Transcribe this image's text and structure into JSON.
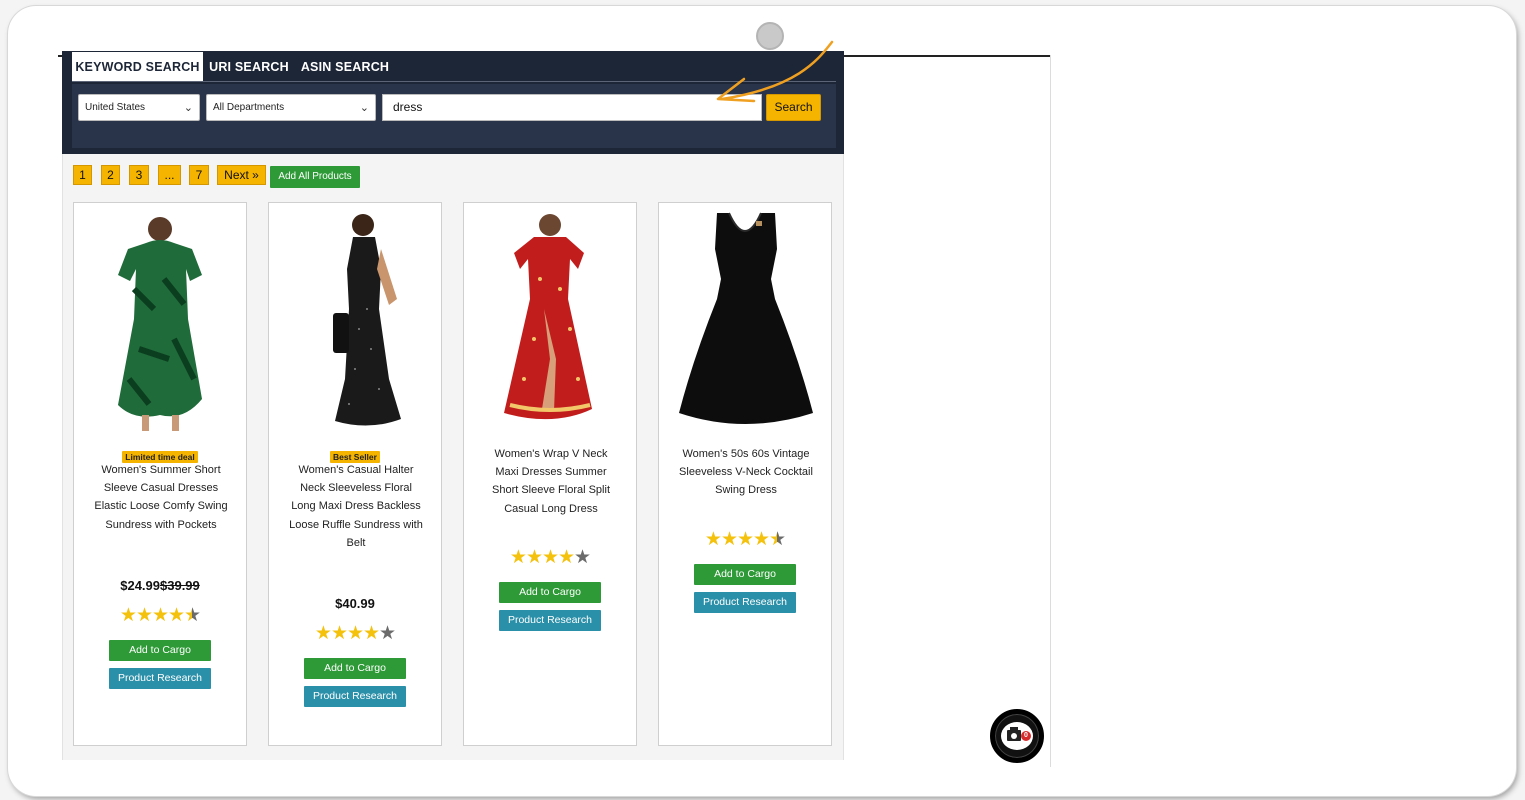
{
  "tabs": [
    {
      "label": "KEYWORD SEARCH",
      "active": true
    },
    {
      "label": "URI SEARCH",
      "active": false
    },
    {
      "label": "ASIN SEARCH",
      "active": false
    }
  ],
  "search": {
    "country": "United States",
    "department": "All Departments",
    "keyword": "dress",
    "button_label": "Search"
  },
  "pagination": {
    "pages": [
      "1",
      "2",
      "3",
      "...",
      "7"
    ],
    "next_label": "Next »",
    "add_all_label": "Add All Products"
  },
  "products": [
    {
      "badge": "Limited time deal",
      "title": "Women's Summer Short Sleeve Casual Dresses Elastic Loose Comfy Swing Sundress with Pockets",
      "price": "$24.99",
      "old_price": "$39.99",
      "rating": 4.5,
      "cargo_label": "Add to Cargo",
      "research_label": "Product Research",
      "image": "green-leaf-dress"
    },
    {
      "badge": "Best Seller",
      "title": "Women's Casual Halter Neck Sleeveless Floral Long Maxi Dress Backless Loose Ruffle Sundress with Belt",
      "price": "$40.99",
      "old_price": "",
      "rating": 4,
      "cargo_label": "Add to Cargo",
      "research_label": "Product Research",
      "image": "black-polka-dot-dress"
    },
    {
      "badge": "",
      "title": "Women's Wrap V Neck Maxi Dresses Summer Short Sleeve Floral Split Casual Long Dress",
      "price": "",
      "old_price": "",
      "rating": 4,
      "cargo_label": "Add to Cargo",
      "research_label": "Product Research",
      "image": "red-floral-maxi-dress"
    },
    {
      "badge": "",
      "title": "Women's 50s 60s Vintage Sleeveless V-Neck Cocktail Swing Dress",
      "price": "",
      "old_price": "",
      "rating": 4.5,
      "cargo_label": "Add to Cargo",
      "research_label": "Product Research",
      "image": "black-swing-dress"
    }
  ],
  "cart": {
    "count": "0"
  },
  "colors": {
    "header_bg": "#1d2637",
    "accent": "#f5b400",
    "cargo_green": "#2e9a37",
    "research_teal": "#2a8fa8",
    "star": "#f4c20d"
  }
}
